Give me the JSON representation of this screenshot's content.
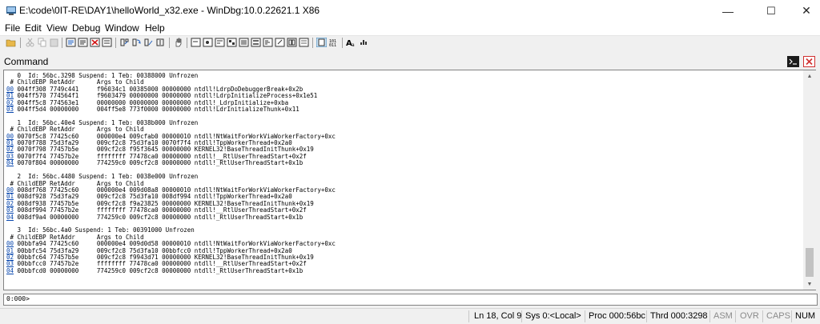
{
  "window": {
    "title": "E:\\code\\0IT-RE\\DAY1\\helloWorld_x32.exe - WinDbg:10.0.22621.1 X86",
    "minimize": "—",
    "maximize": "☐",
    "close": "✕"
  },
  "menu": [
    "File",
    "Edit",
    "View",
    "Debug",
    "Window",
    "Help"
  ],
  "pane": {
    "title": "Command"
  },
  "output_lines": [
    "   0  Id: 56bc.3298 Suspend: 1 Teb: 00388000 Unfrozen",
    " # ChildEBP RetAddr      Args to Child",
    "00 004ff308 7749c441     f96034c1 00385000 00000000 ntdll!LdrpDoDebuggerBreak+0x2b",
    "01 004ff570 774564f1     f9603479 00000000 00000000 ntdll!LdrpInitializeProcess+0x1e51",
    "02 004ff5c8 774563e1     00000000 00000000 00000000 ntdll!_LdrpInitialize+0xba",
    "03 004ff5d4 00000000     004ff5e8 773f0000 00000000 ntdll!LdrInitializeThunk+0x11",
    "",
    "   1  Id: 56bc.40e4 Suspend: 1 Teb: 0038b000 Unfrozen",
    " # ChildEBP RetAddr      Args to Child",
    "00 0070f5c8 77425c60     000000e4 009cfab0 00000010 ntdll!NtWaitForWorkViaWorkerFactory+0xc",
    "01 0070f788 75d3fa29     009cf2c8 75d3fa10 0070f7f4 ntdll!TppWorkerThread+0x2a0",
    "02 0070f798 77457b5e     009cf2c8 f95f3645 00000000 KERNEL32!BaseThreadInitThunk+0x19",
    "03 0070f7f4 77457b2e     ffffffff 77478ca0 00000000 ntdll!__RtlUserThreadStart+0x2f",
    "04 0070f804 00000000     774259c0 009cf2c8 00000000 ntdll!_RtlUserThreadStart+0x1b",
    "",
    "   2  Id: 56bc.4480 Suspend: 1 Teb: 0038e000 Unfrozen",
    " # ChildEBP RetAddr      Args to Child",
    "00 008df768 77425c60     000000e4 009d08a8 00000010 ntdll!NtWaitForWorkViaWorkerFactory+0xc",
    "01 008df928 75d3fa29     009cf2c8 75d3fa10 008df994 ntdll!TppWorkerThread+0x2a0",
    "02 008df938 77457b5e     009cf2c8 f9a23825 00000000 KERNEL32!BaseThreadInitThunk+0x19",
    "03 008df994 77457b2e     ffffffff 77478ca0 00000000 ntdll!__RtlUserThreadStart+0x2f",
    "04 008df9a4 00000000     774259c0 009cf2c8 00000000 ntdll!_RtlUserThreadStart+0x1b",
    "",
    "   3  Id: 56bc.4a0 Suspend: 1 Teb: 00391000 Unfrozen",
    " # ChildEBP RetAddr      Args to Child",
    "00 00bbfa94 77425c60     000000e4 009d0d58 00000010 ntdll!NtWaitForWorkViaWorkerFactory+0xc",
    "01 00bbfc54 75d3fa29     009cf2c8 75d3fa10 00bbfcc0 ntdll!TppWorkerThread+0x2a0",
    "02 00bbfc64 77457b5e     009cf2c8 f9943d71 00000000 KERNEL32!BaseThreadInitThunk+0x19",
    "03 00bbfcc0 77457b2e     ffffffff 77478ca0 00000000 ntdll!__RtlUserThreadStart+0x2f",
    "04 00bbfcd0 00000000     774259c0 009cf2c8 00000000 ntdll!_RtlUserThreadStart+0x1b"
  ],
  "command": {
    "prompt": "0:000>",
    "value": ""
  },
  "status": {
    "position": "Ln 18, Col 9",
    "sys": "Sys 0:<Local>",
    "proc": "Proc 000:56bc",
    "thrd": "Thrd 000:3298",
    "asm": "ASM",
    "ovr": "OVR",
    "caps": "CAPS",
    "num": "NUM"
  },
  "colors": {
    "link": "#0645ad",
    "status_dim": "#8a8a8a"
  }
}
